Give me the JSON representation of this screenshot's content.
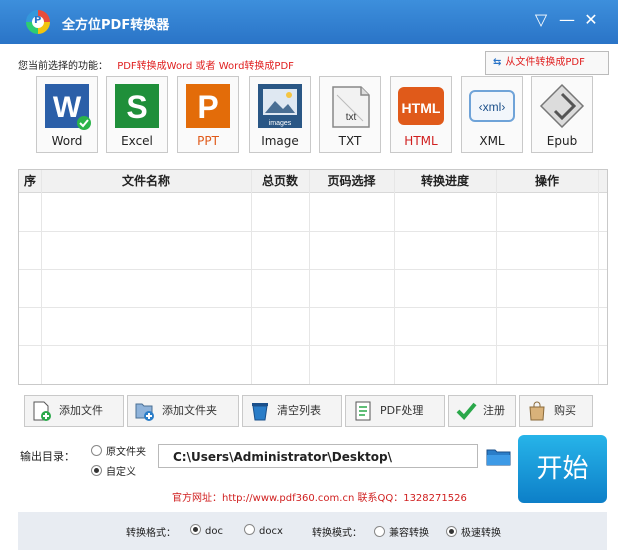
{
  "app": {
    "title": "全方位PDF转换器"
  },
  "current": {
    "label": "您当前选择的功能：",
    "value": "PDF转换成Word 或者 Word转换成PDF"
  },
  "from_file": {
    "label": "从文件转换成PDF"
  },
  "formats": [
    {
      "name": "word",
      "label": "Word",
      "color": "#2b5fa8"
    },
    {
      "name": "excel",
      "label": "Excel",
      "color": "#1f8f3a"
    },
    {
      "name": "ppt",
      "label": "PPT",
      "color": "#e36c09"
    },
    {
      "name": "image",
      "label": "Image",
      "color": "#2a5785"
    },
    {
      "name": "txt",
      "label": "TXT",
      "color": "#6c6c6c"
    },
    {
      "name": "html",
      "label": "HTML",
      "color": "#e05a1a"
    },
    {
      "name": "xml",
      "label": "XML",
      "color": "#2a7dc8"
    },
    {
      "name": "epub",
      "label": "Epub",
      "color": "#555"
    }
  ],
  "table": {
    "headers": [
      "序",
      "文件名称",
      "总页数",
      "页码选择",
      "转换进度",
      "操作"
    ]
  },
  "toolbar": [
    {
      "name": "add-file",
      "label": "添加文件"
    },
    {
      "name": "add-folder",
      "label": "添加文件夹"
    },
    {
      "name": "clear-list",
      "label": "清空列表"
    },
    {
      "name": "pdf-process",
      "label": "PDF处理"
    },
    {
      "name": "register",
      "label": "注册"
    },
    {
      "name": "buy",
      "label": "购买"
    }
  ],
  "output": {
    "label": "输出目录：",
    "option_original": "原文件夹",
    "option_custom": "自定义",
    "selected": "自定义",
    "path": "C:\\Users\\Administrator\\Desktop\\"
  },
  "start_label": "开始",
  "website": "官方网址：http://www.pdf360.com.cn    联系QQ：1328271526",
  "bottom": {
    "format_label": "转换格式：",
    "format_doc": "doc",
    "format_docx": "docx",
    "format_selected": "doc",
    "mode_label": "转换模式：",
    "mode_compatible": "兼容转换",
    "mode_fast": "极速转换",
    "mode_selected": "极速转换"
  }
}
